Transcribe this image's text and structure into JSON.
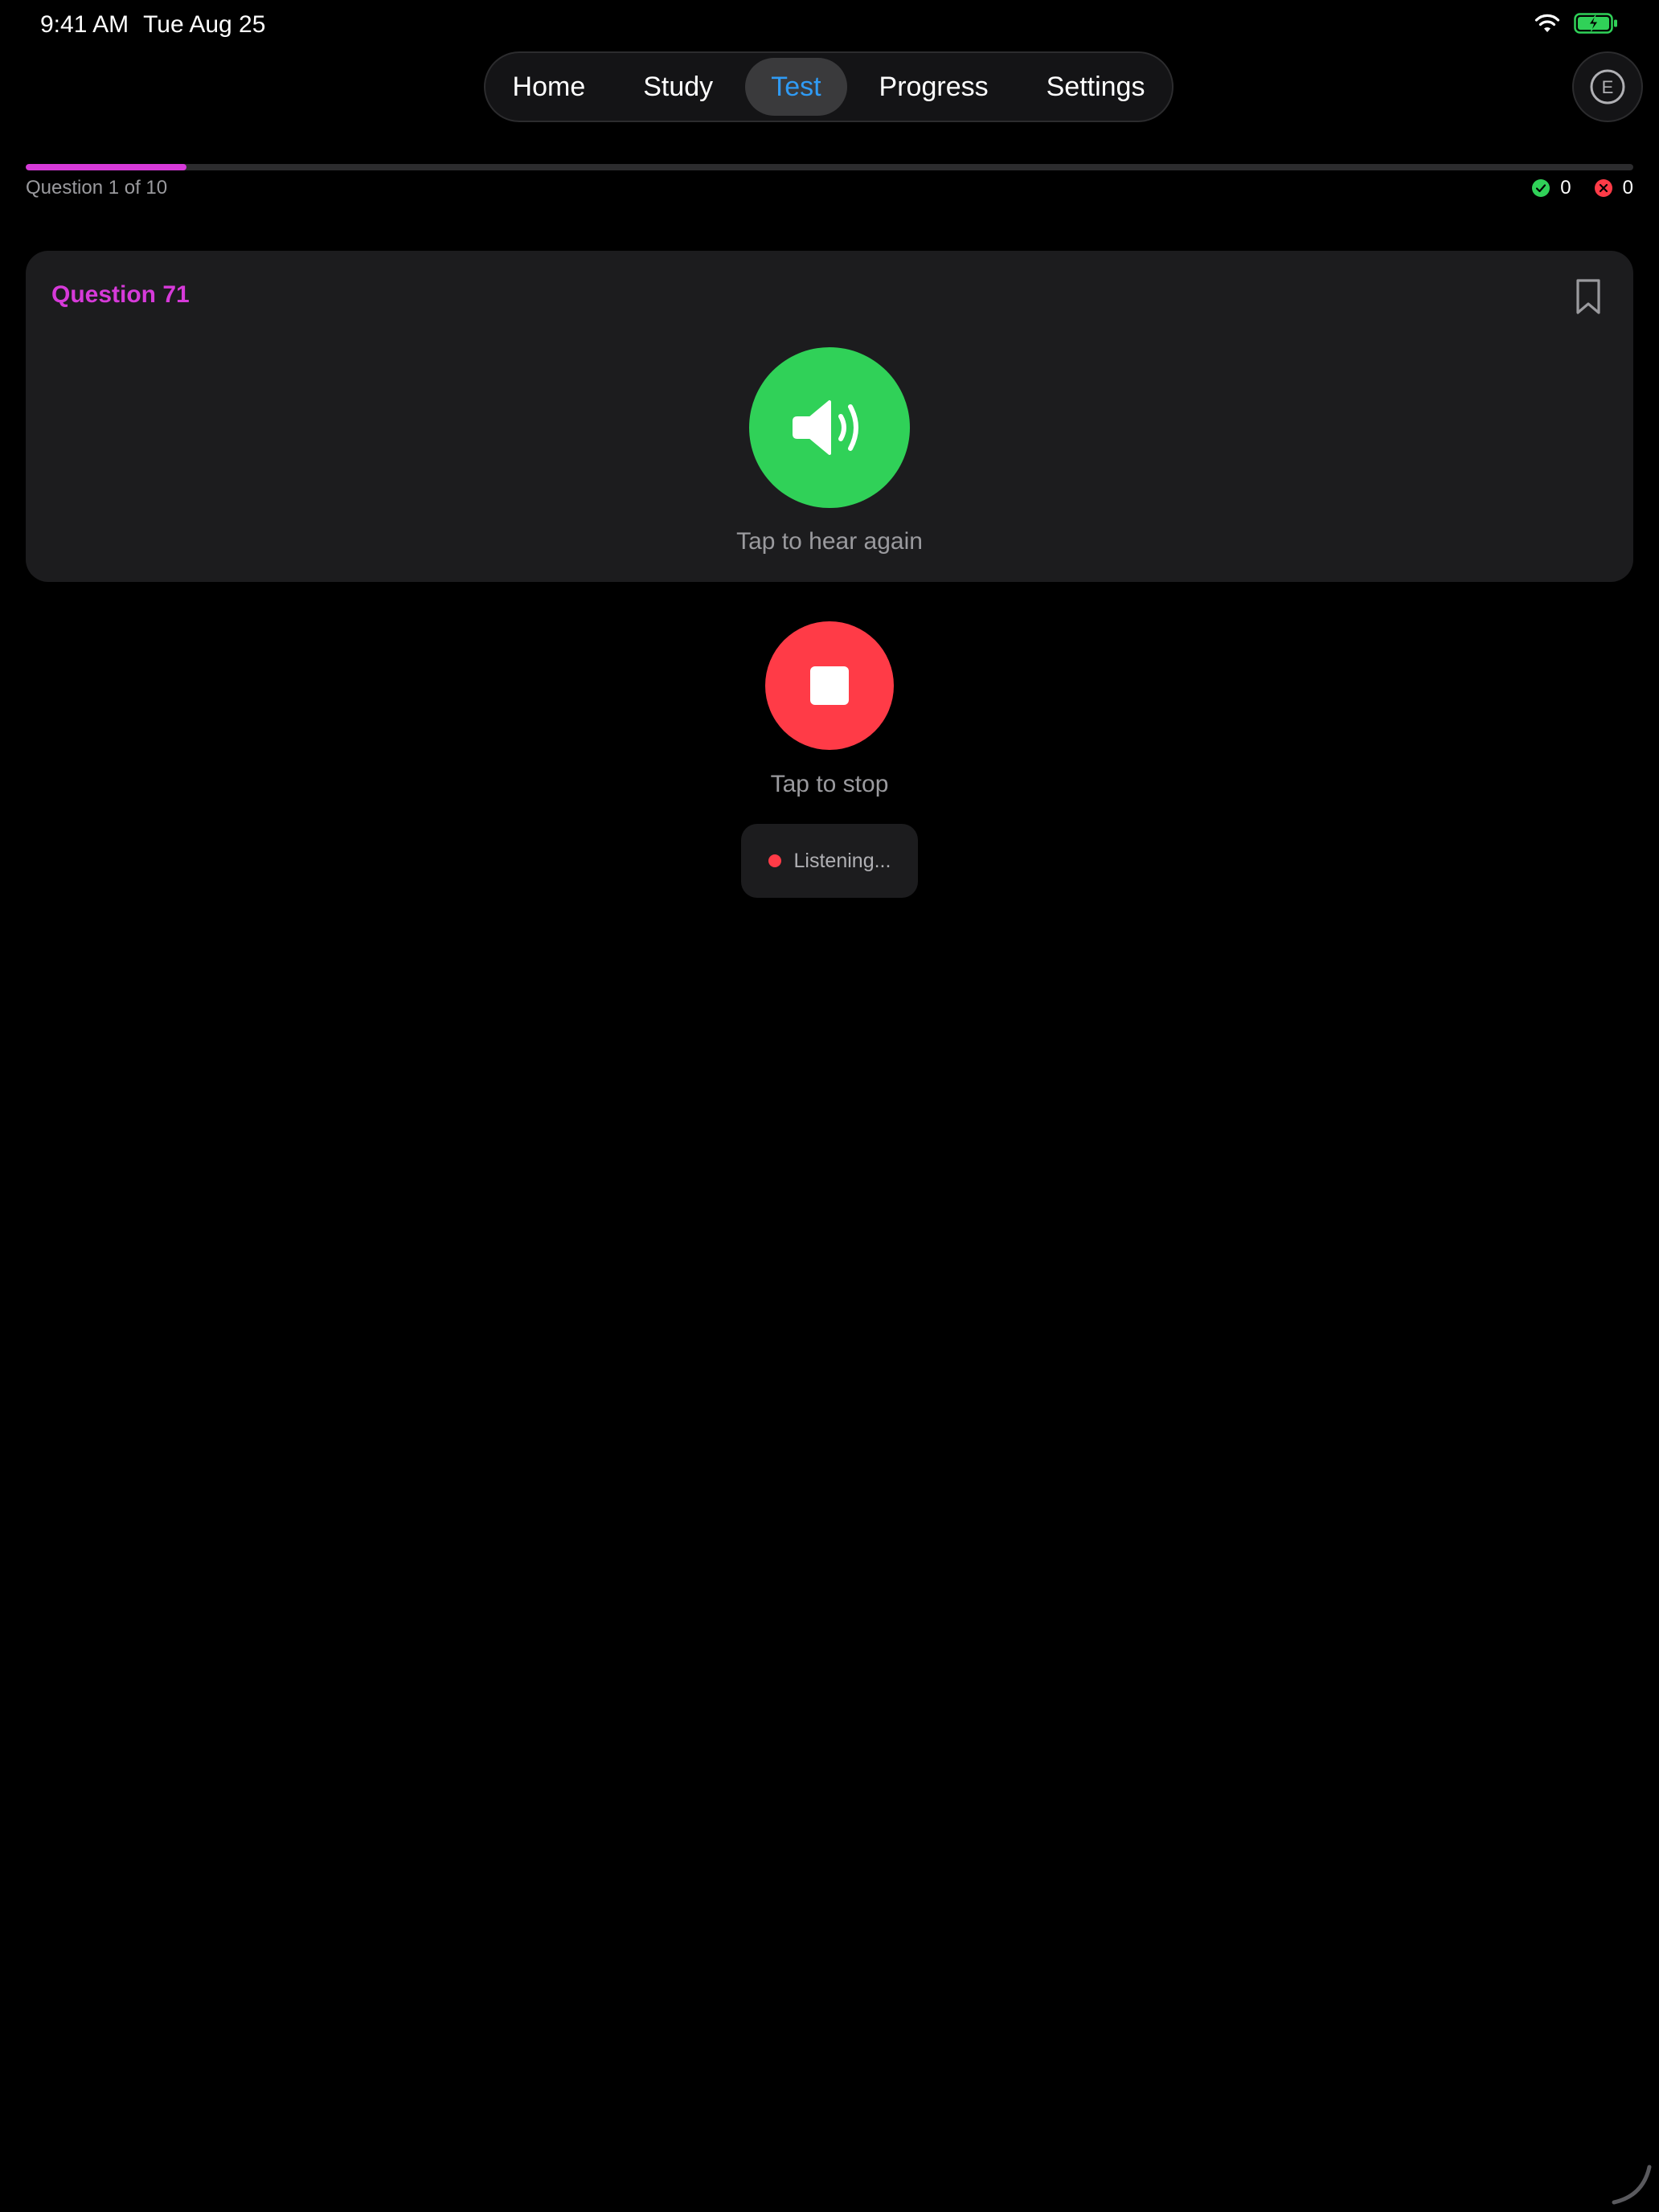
{
  "status_bar": {
    "time": "9:41 AM",
    "date": "Tue Aug 25",
    "icons": [
      "wifi-icon",
      "battery-charging-icon"
    ]
  },
  "nav": {
    "tabs": [
      {
        "label": "Home",
        "active": false
      },
      {
        "label": "Study",
        "active": false
      },
      {
        "label": "Test",
        "active": true
      },
      {
        "label": "Progress",
        "active": false
      },
      {
        "label": "Settings",
        "active": false
      }
    ],
    "avatar_letter": "E"
  },
  "progress": {
    "label": "Question 1 of 10",
    "current": 1,
    "total": 10,
    "fraction": 0.1,
    "correct_count": "0",
    "incorrect_count": "0"
  },
  "question": {
    "title": "Question 71",
    "hear_again_label": "Tap to hear again"
  },
  "recorder": {
    "stop_label": "Tap to stop",
    "status": "Listening..."
  },
  "colors": {
    "accent_magenta": "#d63ad9",
    "active_tab_blue": "#2f9bf5",
    "speaker_green": "#30d158",
    "stop_red": "#ff3b47",
    "card_bg": "#1c1c1e"
  }
}
